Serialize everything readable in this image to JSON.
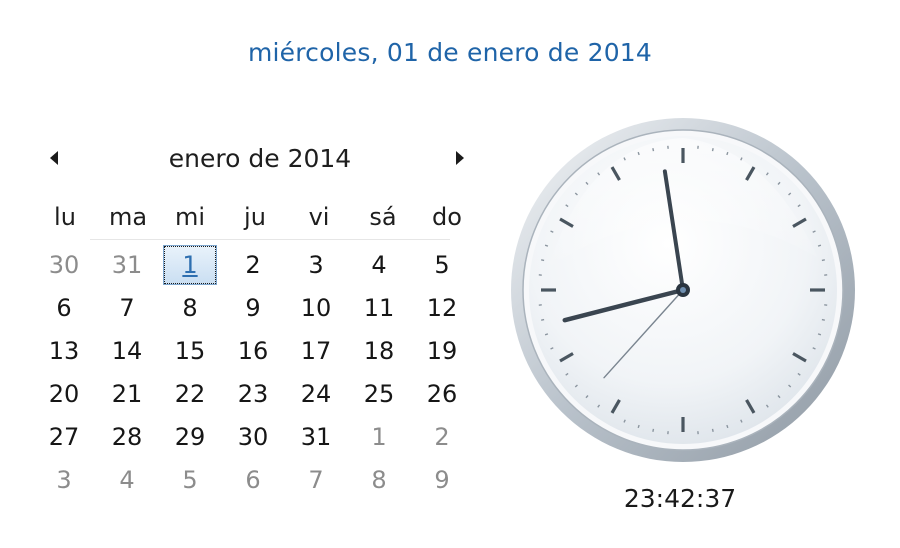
{
  "header": {
    "full_date": "miércoles, 01 de enero de 2014"
  },
  "calendar": {
    "month_label": "enero de 2014",
    "weekdays": [
      "lu",
      "ma",
      "mi",
      "ju",
      "vi",
      "sá",
      "do"
    ],
    "weeks": [
      [
        {
          "d": "30",
          "other": true
        },
        {
          "d": "31",
          "other": true
        },
        {
          "d": "1",
          "selected": true
        },
        {
          "d": "2"
        },
        {
          "d": "3"
        },
        {
          "d": "4"
        },
        {
          "d": "5"
        }
      ],
      [
        {
          "d": "6"
        },
        {
          "d": "7"
        },
        {
          "d": "8"
        },
        {
          "d": "9"
        },
        {
          "d": "10"
        },
        {
          "d": "11"
        },
        {
          "d": "12"
        }
      ],
      [
        {
          "d": "13"
        },
        {
          "d": "14"
        },
        {
          "d": "15"
        },
        {
          "d": "16"
        },
        {
          "d": "17"
        },
        {
          "d": "18"
        },
        {
          "d": "19"
        }
      ],
      [
        {
          "d": "20"
        },
        {
          "d": "21"
        },
        {
          "d": "22"
        },
        {
          "d": "23"
        },
        {
          "d": "24"
        },
        {
          "d": "25"
        },
        {
          "d": "26"
        }
      ],
      [
        {
          "d": "27"
        },
        {
          "d": "28"
        },
        {
          "d": "29"
        },
        {
          "d": "30"
        },
        {
          "d": "31"
        },
        {
          "d": "1",
          "other": true
        },
        {
          "d": "2",
          "other": true
        }
      ],
      [
        {
          "d": "3",
          "other": true
        },
        {
          "d": "4",
          "other": true
        },
        {
          "d": "5",
          "other": true
        },
        {
          "d": "6",
          "other": true
        },
        {
          "d": "7",
          "other": true
        },
        {
          "d": "8",
          "other": true
        },
        {
          "d": "9",
          "other": true
        }
      ]
    ]
  },
  "clock": {
    "time": "23:42:37",
    "hours": 23,
    "minutes": 42,
    "seconds": 37
  },
  "colors": {
    "accent": "#1f64a8",
    "other_month": "#8c8c8c",
    "hand": "#3a4550",
    "second_hand": "#7a8590"
  },
  "icons": {
    "prev": "triangle-left-icon",
    "next": "triangle-right-icon"
  }
}
